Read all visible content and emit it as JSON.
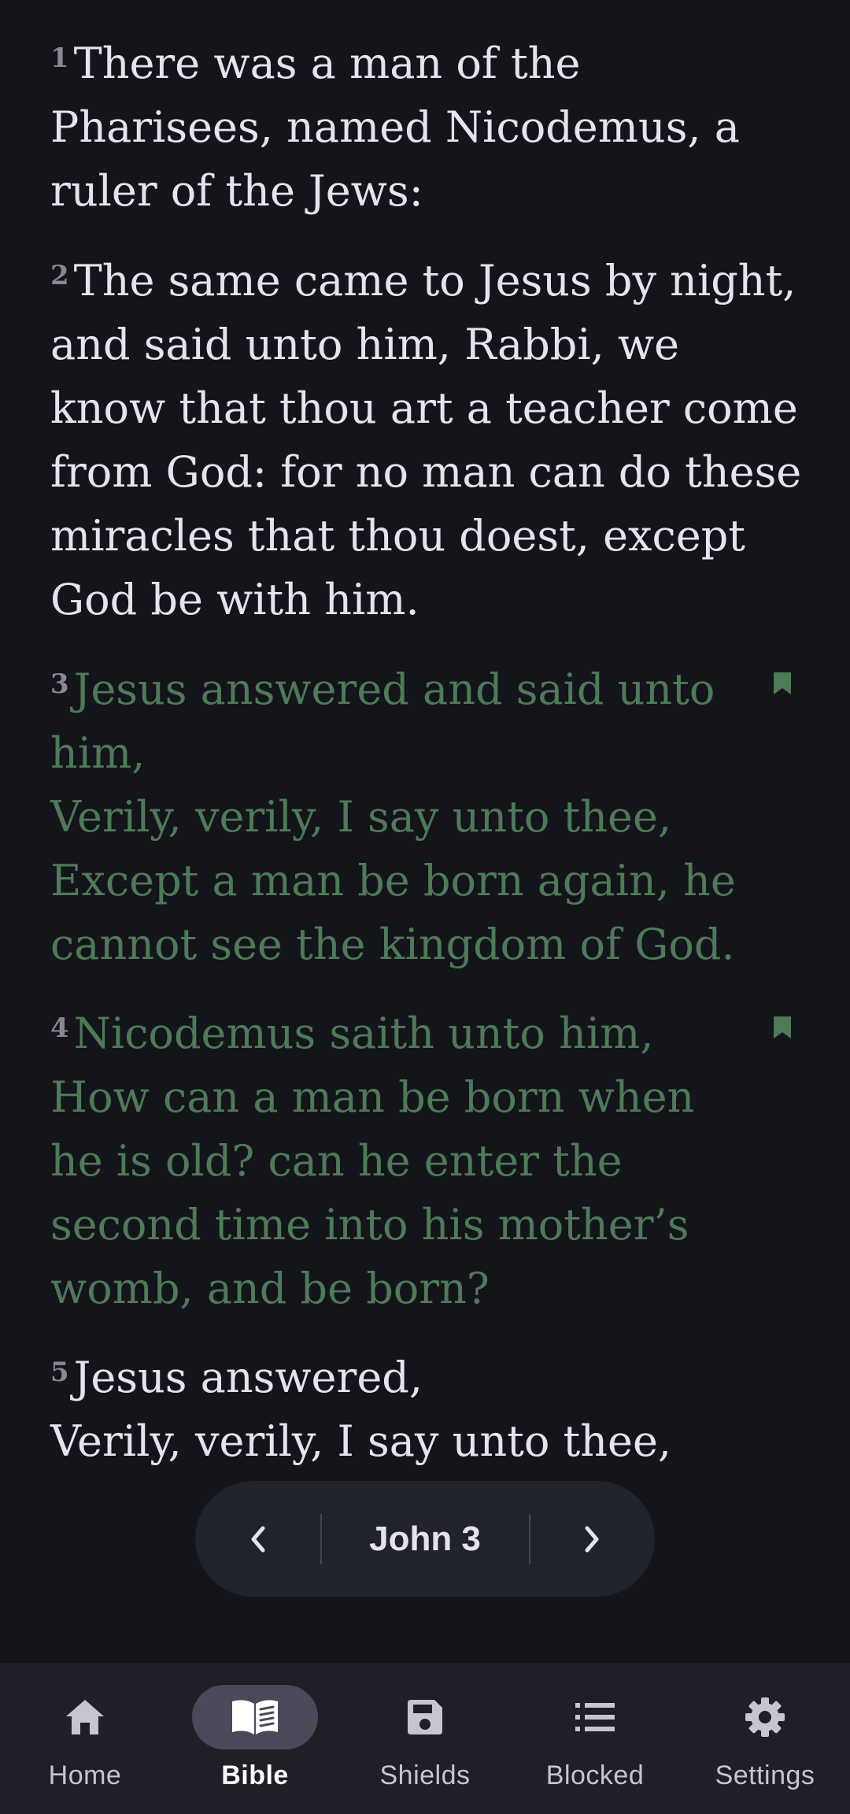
{
  "reader": {
    "verses": [
      {
        "number": "1",
        "text": "There was a man of the Pharisees, named Nicodemus, a ruler of the Jews:",
        "highlighted": false,
        "bookmarked": false
      },
      {
        "number": "2",
        "text": "The same came to Jesus by night, and said unto him, Rabbi, we know that thou art a teacher come from God: for no man can do these miracles that thou doest, except God be with him.",
        "highlighted": false,
        "bookmarked": false
      },
      {
        "number": "3",
        "text": "Jesus answered and said unto him,\nVerily, verily, I say unto thee, Except a man be born again, he cannot see the kingdom of God.",
        "highlighted": true,
        "bookmarked": true
      },
      {
        "number": "4",
        "text": "Nicodemus saith unto him,\nHow can a man be born when he is old? can he enter the second time into his mother’s womb, and be born?",
        "highlighted": true,
        "bookmarked": true
      },
      {
        "number": "5",
        "text": "Jesus answered,\nVerily, verily, I say unto thee,",
        "highlighted": false,
        "bookmarked": false
      }
    ]
  },
  "chapter_nav": {
    "previous_icon": "chevron-left-icon",
    "next_icon": "chevron-right-icon",
    "chapter_label": "John 3"
  },
  "bottom_nav": {
    "tabs": [
      {
        "label": "Home",
        "icon": "home-icon",
        "active": false
      },
      {
        "label": "Bible",
        "icon": "book-icon",
        "active": true
      },
      {
        "label": "Shields",
        "icon": "save-icon",
        "active": false
      },
      {
        "label": "Blocked",
        "icon": "list-icon",
        "active": false
      },
      {
        "label": "Settings",
        "icon": "gear-icon",
        "active": false
      }
    ]
  },
  "colors": {
    "background": "#14141b",
    "verse_text": "#e7e3ec",
    "highlight_text": "#4e7a57",
    "bookmark": "#4e7a57",
    "nav_pill": "#20232b",
    "bottom_nav": "#1e1f27",
    "active_indicator": "#4c4859"
  }
}
